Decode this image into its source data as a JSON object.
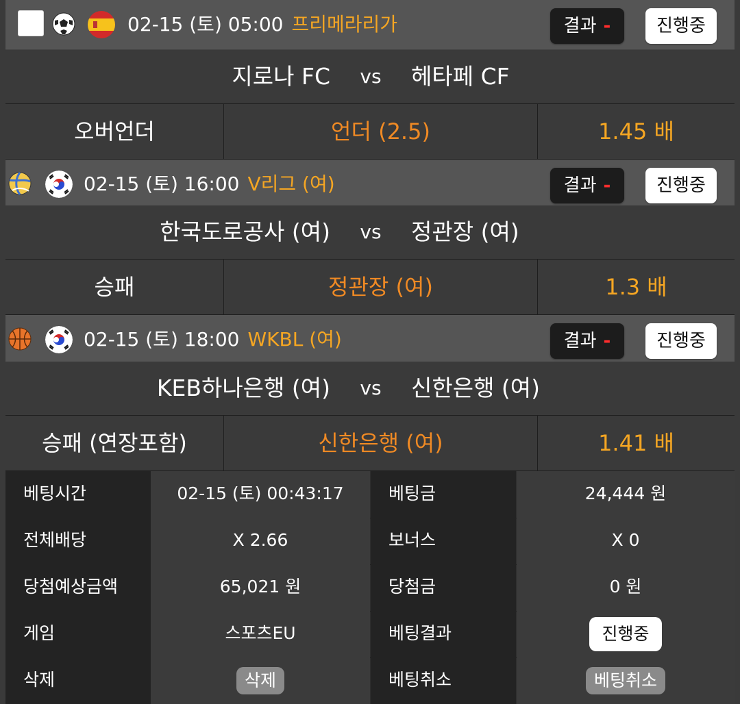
{
  "bets": [
    {
      "date": "02-15 (토) 05:00",
      "league": "프리메라리가",
      "sport_icon": "soccer-ball-icon",
      "flag": "spain-flag-icon",
      "result_label": "결과",
      "result_value": "-",
      "status_label": "진행중",
      "team_home": "지로나 FC",
      "vs": "vs",
      "team_away": "헤타페 CF",
      "market": "오버언더",
      "pick": "언더 (2.5)",
      "odds": "1.45 배"
    },
    {
      "date": "02-15 (토) 16:00",
      "league": "V리그 (여)",
      "sport_icon": "volleyball-icon",
      "flag": "korea-flag-icon",
      "result_label": "결과",
      "result_value": "-",
      "status_label": "진행중",
      "team_home": "한국도로공사 (여)",
      "vs": "vs",
      "team_away": "정관장 (여)",
      "market": "승패",
      "pick": "정관장 (여)",
      "odds": "1.3 배"
    },
    {
      "date": "02-15 (토) 18:00",
      "league": "WKBL (여)",
      "sport_icon": "basketball-icon",
      "flag": "korea-flag-icon",
      "result_label": "결과",
      "result_value": "-",
      "status_label": "진행중",
      "team_home": "KEB하나은행 (여)",
      "vs": "vs",
      "team_away": "신한은행 (여)",
      "market": "승패 (연장포함)",
      "pick": "신한은행 (여)",
      "odds": "1.41 배"
    }
  ],
  "summary": {
    "bet_time_label": "베팅시간",
    "bet_time_value": "02-15 (토) 00:43:17",
    "bet_amount_label": "베팅금",
    "bet_amount_value": "24,444 원",
    "total_odds_label": "전체배당",
    "total_odds_value": "X 2.66",
    "bonus_label": "보너스",
    "bonus_value": "X 0",
    "expected_win_label": "당첨예상금액",
    "expected_win_value": "65,021 원",
    "win_amount_label": "당첨금",
    "win_amount_value": "0 원",
    "game_label": "게임",
    "game_value": "스포츠EU",
    "bet_result_label": "베팅결과",
    "bet_result_value": "진행중",
    "delete_label": "삭제",
    "delete_button": "삭제",
    "cancel_label": "베팅취소",
    "cancel_button": "베팅취소"
  },
  "colors": {
    "accent_orange": "#f5a623",
    "pick_orange": "#f08a24",
    "result_dash_red": "#ff2d2d",
    "header_bg": "#555555",
    "row_bg": "#3a3a3a"
  }
}
